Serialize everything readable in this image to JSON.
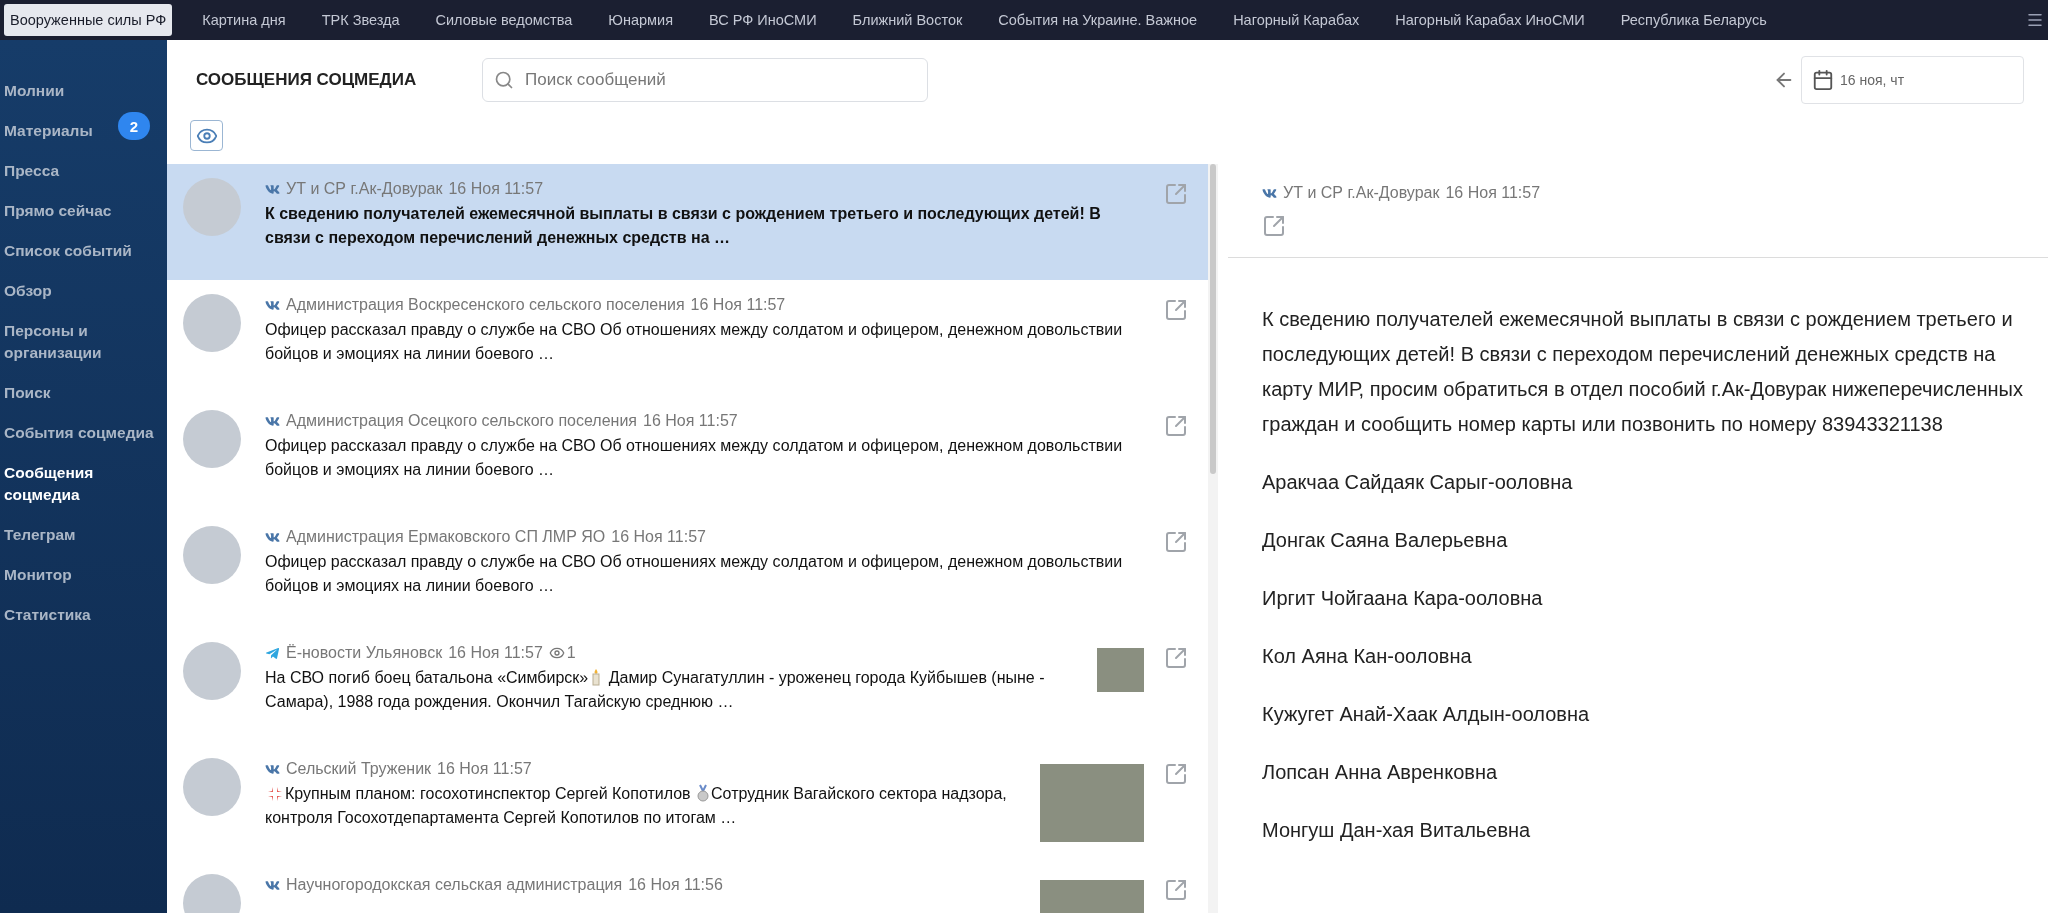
{
  "nav_tabs": [
    {
      "label": "Вооруженные силы РФ",
      "selected": true
    },
    {
      "label": "Картина дня",
      "selected": false
    },
    {
      "label": "ТРК Звезда",
      "selected": false
    },
    {
      "label": "Силовые ведомства",
      "selected": false
    },
    {
      "label": "Юнармия",
      "selected": false
    },
    {
      "label": "ВС РФ ИноСМИ",
      "selected": false
    },
    {
      "label": "Ближний Восток",
      "selected": false
    },
    {
      "label": "События на Украине. Важное",
      "selected": false
    },
    {
      "label": "Нагорный Карабах",
      "selected": false
    },
    {
      "label": "Нагорный Карабах ИноСМИ",
      "selected": false
    },
    {
      "label": "Республика Беларусь",
      "selected": false
    }
  ],
  "sidebar": {
    "items": [
      {
        "label": "Молнии",
        "selected": false
      },
      {
        "label": "Материалы",
        "selected": false,
        "badge": "2"
      },
      {
        "label": "Пресса",
        "selected": false
      },
      {
        "label": "Прямо сейчас",
        "selected": false
      },
      {
        "label": "Список событий",
        "selected": false
      },
      {
        "label": "Обзор",
        "selected": false
      },
      {
        "label": "Персоны и организации",
        "selected": false
      },
      {
        "label": "Поиск",
        "selected": false
      },
      {
        "label": "События соцмедиа",
        "selected": false
      },
      {
        "label": "Сообщения соцмедиа",
        "selected": true
      },
      {
        "label": "Телеграм",
        "selected": false
      },
      {
        "label": "Монитор",
        "selected": false
      },
      {
        "label": "Статистика",
        "selected": false
      }
    ]
  },
  "header": {
    "title": "СООБЩЕНИЯ СОЦМЕДИА",
    "search": {
      "placeholder": "Поиск сообщений"
    },
    "date": "16 ноя, чт"
  },
  "messages": [
    {
      "kind": "vk",
      "source": "УТ и СР г.Ак-Довурак",
      "time": "16 Ноя 11:57",
      "selected": true,
      "text": [
        {
          "kind": "text",
          "text": "К сведению получателей ежемесячной выплаты в связи с рождением третьего и последующих детей! В связи с переходом перечислений денежных средств на …"
        }
      ]
    },
    {
      "kind": "vk",
      "source": "Администрация Воскресенского сельского поселения",
      "time": "16 Ноя 11:57",
      "selected": false,
      "text": [
        {
          "kind": "text",
          "text": "Офицер рассказал правду о службе на СВО Об отношениях между солдатом и офицером, денежном довольствии бойцов и эмоциях на линии боевого …"
        }
      ]
    },
    {
      "kind": "vk",
      "source": "Администрация Осецкого сельского поселения",
      "time": "16 Ноя 11:57",
      "selected": false,
      "text": [
        {
          "kind": "text",
          "text": "Офицер рассказал правду о службе на СВО Об отношениях между солдатом и офицером, денежном довольствии бойцов и эмоциях на линии боевого …"
        }
      ]
    },
    {
      "kind": "vk",
      "source": "Администрация Ермаковского СП ЛМР ЯО",
      "time": "16 Ноя 11:57",
      "selected": false,
      "text": [
        {
          "kind": "text",
          "text": "Офицер рассказал правду о службе на СВО Об отношениях между солдатом и офицером, денежном довольствии бойцов и эмоциях на линии боевого …"
        }
      ]
    },
    {
      "kind": "telegram",
      "source": "Ё-новости Ульяновск",
      "time": "16 Ноя 11:57",
      "views": "1",
      "selected": false,
      "thumbnail": {
        "kind": "small"
      },
      "text": [
        {
          "kind": "text",
          "text": "На СВО погиб боец батальона «Симбирск»"
        },
        {
          "kind": "candle"
        },
        {
          "kind": "text",
          "text": " Дамир Сунагатуллин - уроженец города Куйбышев (ныне - Самара), 1988 года рождения. Окончил Тагайскую среднюю …"
        }
      ]
    },
    {
      "kind": "vk",
      "source": "Сельский Труженик",
      "time": "16 Ноя 11:57",
      "selected": false,
      "thumbnail": {
        "kind": "large"
      },
      "text": [
        {
          "kind": "anger"
        },
        {
          "kind": "text",
          "text": "Крупным планом: госохотинспектор Сергей Копотилов "
        },
        {
          "kind": "medal"
        },
        {
          "kind": "text",
          "text": "Сотрудник Вагайского сектора надзора, контроля Госохотдепартамента Сергей Копотилов по итогам …"
        }
      ]
    },
    {
      "kind": "vk",
      "source": "Научногородокская сельская администрация",
      "time": "16 Ноя 11:56",
      "selected": false,
      "thumbnail": {
        "kind": "large"
      }
    }
  ],
  "detail": {
    "kind": "vk",
    "source": "УТ и СР г.Ак-Довурак",
    "time": "16 Ноя 11:57",
    "paragraphs": [
      "К сведению получателей ежемесячной выплаты в связи с рождением третьего и последующих детей! В связи с переходом перечислений денежных средств на карту МИР, просим обратиться в отдел пособий г.Ак-Довурак нижеперечисленных граждан и сообщить номер карты или позвонить по номеру 83943321138",
      "Аракчаа Сайдаяк Сарыг-ооловна",
      "Донгак Саяна Валерьевна",
      "Иргит Чойгаана Кара-ооловна",
      "Кол Аяна Кан-ооловна",
      "Кужугет Анай-Хаак Алдын-ооловна",
      "Лопсан Анна Авренковна",
      "Монгуш Дан-хая Витальевна"
    ]
  }
}
